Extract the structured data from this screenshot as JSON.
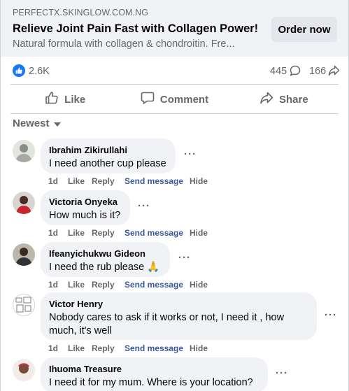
{
  "ad": {
    "domain": "PERFECTX.SKINGLOW.COM.NG",
    "title": "Relieve Joint Pain Fast with Collagen Power!",
    "description": "Natural formula with collagen & chondroitin. Fre...",
    "cta_label": "Order now"
  },
  "stats": {
    "reactions": "2.6K",
    "comments": "445",
    "shares": "166"
  },
  "actions": {
    "like": "Like",
    "comment": "Comment",
    "share": "Share"
  },
  "sort": {
    "label": "Newest"
  },
  "comments": [
    {
      "name": "Ibrahim Zikirullahi",
      "text": "I need another cup please",
      "time": "1d",
      "like": "Like",
      "reply": "Reply",
      "message": "Send message",
      "hide": "Hide",
      "more": "···"
    },
    {
      "name": "Victoria Onyeka",
      "text": "How much is it?",
      "time": "1d",
      "like": "Like",
      "reply": "Reply",
      "message": "Send message",
      "hide": "Hide",
      "more": "···"
    },
    {
      "name": "Ifeanyichukwu Gideon",
      "text": "I need the rub please 🙏",
      "time": "1d",
      "like": "Like",
      "reply": "Reply",
      "message": "Send message",
      "hide": "Hide",
      "more": "···"
    },
    {
      "name": "Victor Henry",
      "text": "Nobody cares to ask if it works or not, I need it , how much, it's well",
      "time": "1d",
      "like": "Like",
      "reply": "Reply",
      "message": "Send message",
      "hide": "Hide",
      "more": "···"
    },
    {
      "name": "Ihuoma Treasure",
      "text": "I need it for my mum. Where is your location?",
      "more": "···"
    }
  ],
  "colors": {
    "brand_blue": "#1877f2",
    "link_blue": "#385898",
    "muted": "#65676b",
    "bubble_bg": "#f0f2f5"
  }
}
